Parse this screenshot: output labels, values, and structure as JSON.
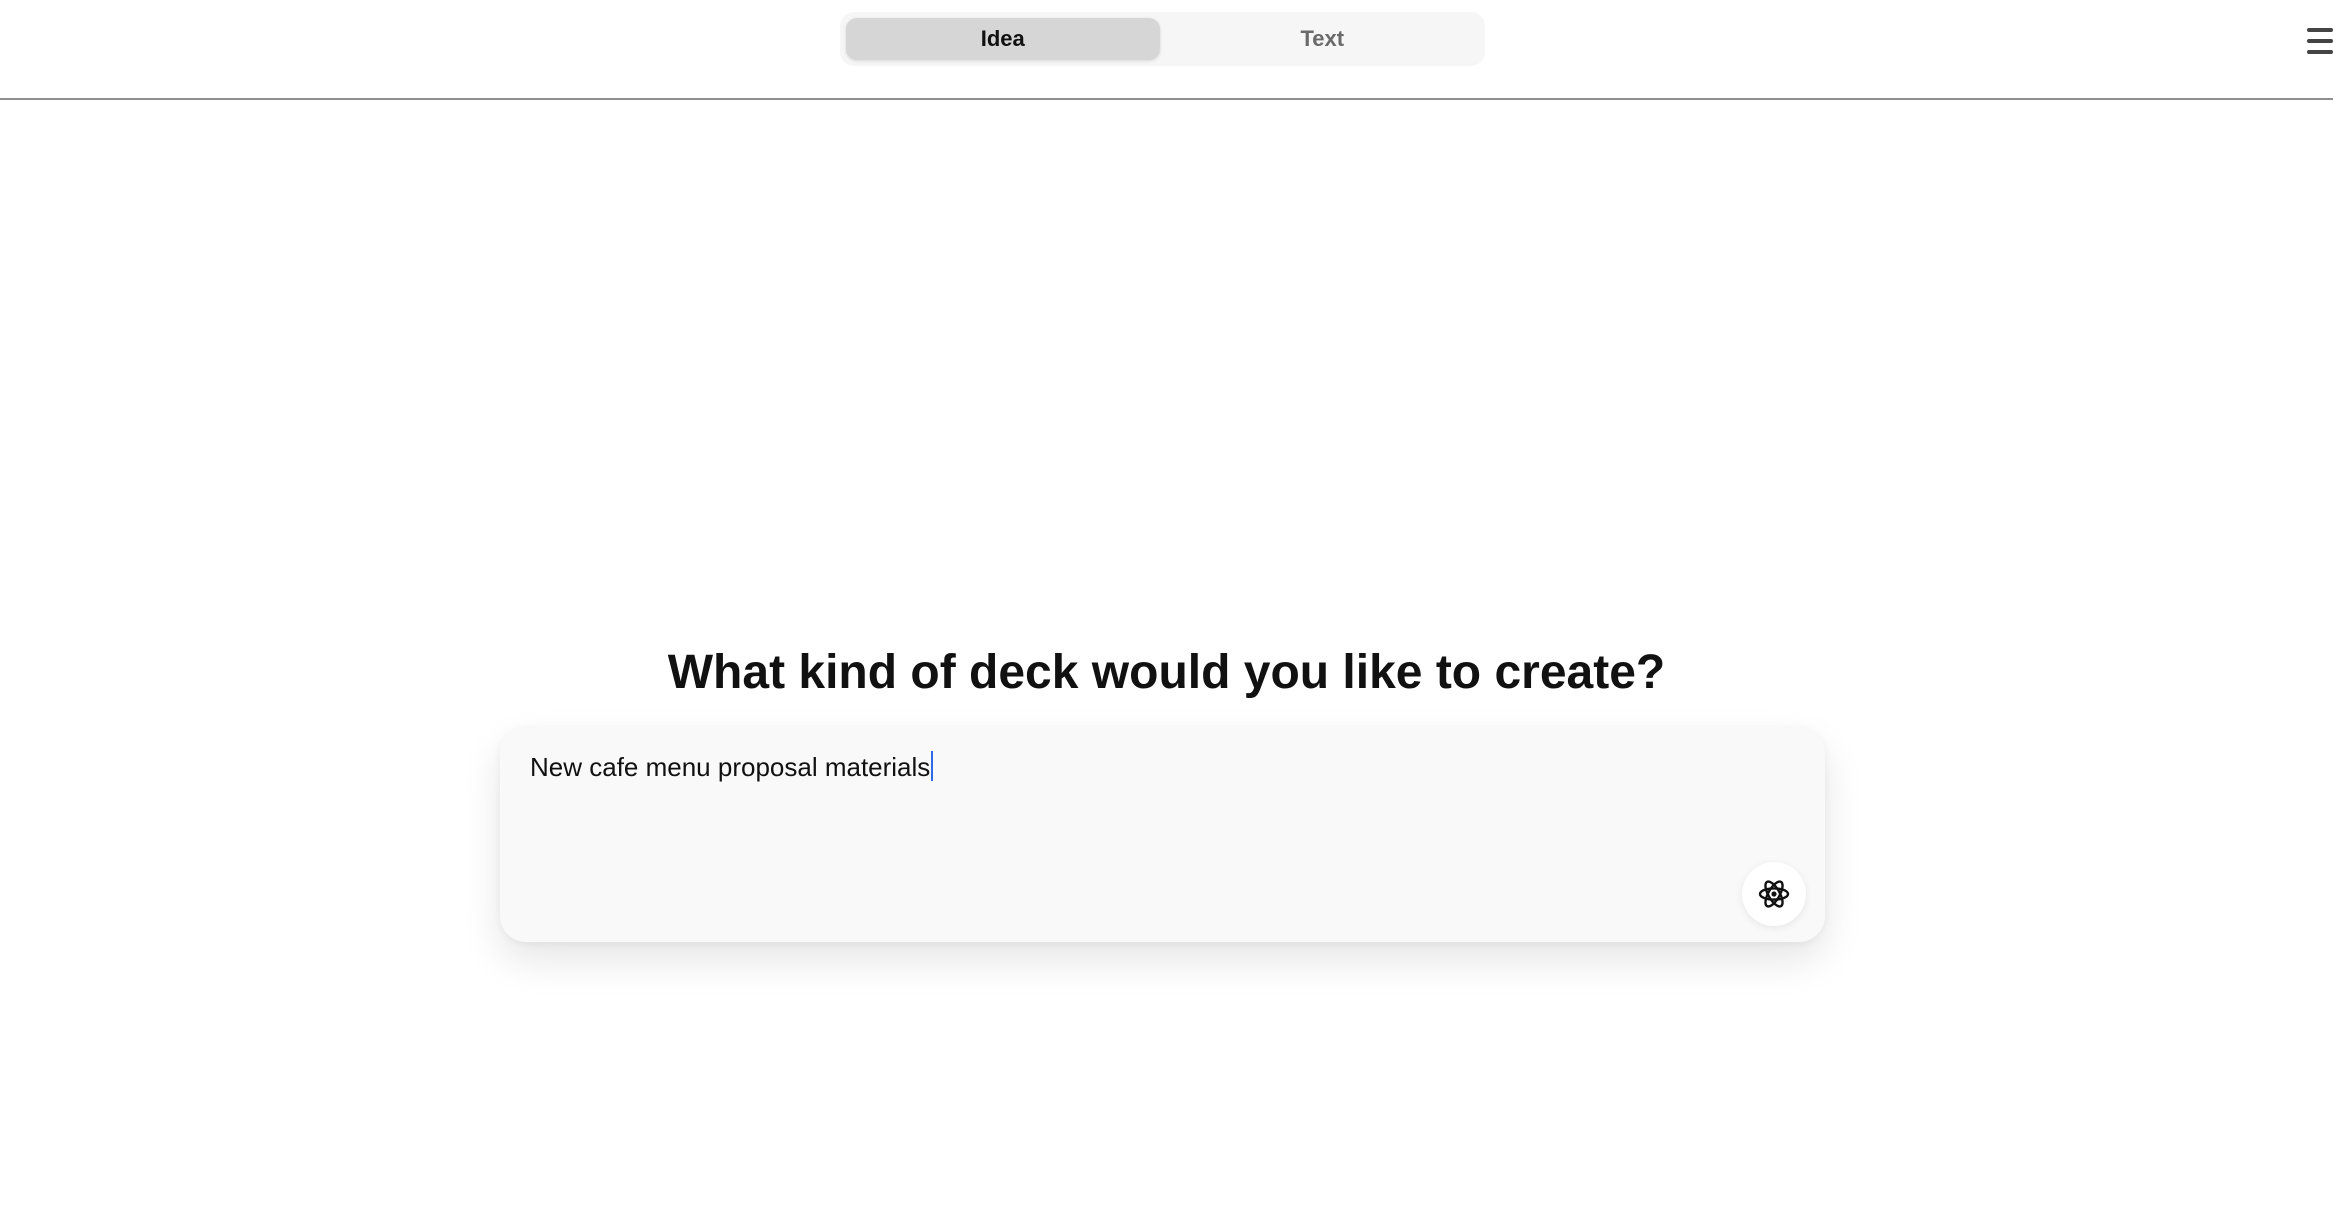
{
  "header": {
    "mode_tabs": [
      {
        "label": "Idea",
        "active": true
      },
      {
        "label": "Text",
        "active": false
      }
    ],
    "menu_icon": "hamburger-menu-icon"
  },
  "main": {
    "headline": "What kind of deck would you like to create?",
    "prompt": {
      "value": "New cafe menu proposal materials",
      "generate_icon": "atom-icon"
    }
  },
  "colors": {
    "caret": "#2d6be4",
    "active_tab_bg": "#d6d6d6",
    "toggle_bg": "#f6f6f6",
    "card_bg": "#f9f9f9"
  }
}
